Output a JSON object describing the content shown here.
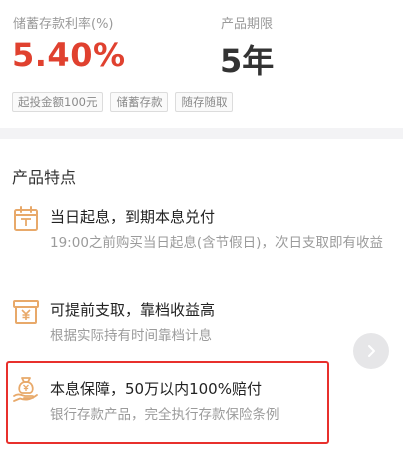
{
  "summary": {
    "rate_label": "储蓄存款利率(%)",
    "rate_value": "5.40%",
    "term_label": "产品期限",
    "term_value": "5年",
    "tags": [
      "起投金额100元",
      "储蓄存款",
      "随存随取"
    ]
  },
  "features": {
    "section_title": "产品特点",
    "items": [
      {
        "icon": "calendar-icon",
        "title": "当日起息，到期本息兑付",
        "desc": "19:00之前购买当日起息(含节假日)，次日支取即有收益"
      },
      {
        "icon": "yen-box-icon",
        "title": "可提前支取，靠档收益高",
        "desc": "根据实际持有时间靠档计息"
      },
      {
        "icon": "money-bag-hand-icon",
        "title": "本息保障，50万以内100%赔付",
        "desc": "银行存款产品，完全执行存款保险条例"
      }
    ]
  },
  "colors": {
    "rate_red": "#e0412f",
    "icon_orange": "#e8a96a",
    "highlight_red": "#e8302c"
  }
}
